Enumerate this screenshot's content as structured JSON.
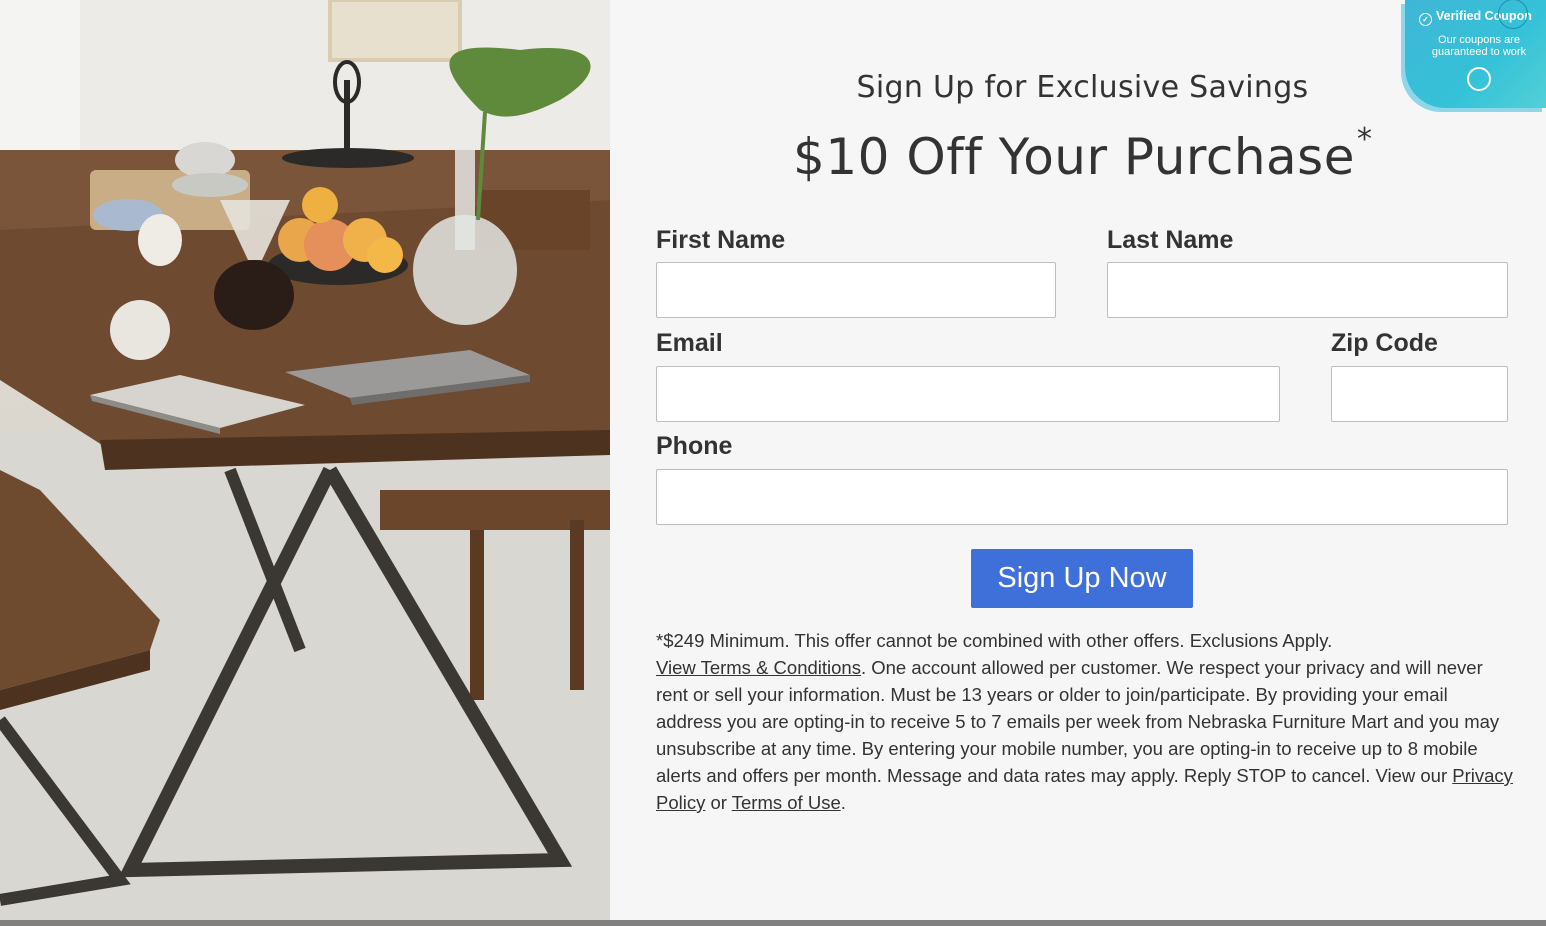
{
  "form": {
    "subtitle": "Sign Up for Exclusive Savings",
    "headline": "$10 Off Your Purchase",
    "headline_asterisk": "*",
    "fields": {
      "first_name": {
        "label": "First Name",
        "value": ""
      },
      "last_name": {
        "label": "Last Name",
        "value": ""
      },
      "email": {
        "label": "Email",
        "value": ""
      },
      "zip": {
        "label": "Zip Code",
        "value": ""
      },
      "phone": {
        "label": "Phone",
        "value": ""
      }
    },
    "submit_label": "Sign Up Now",
    "colors": {
      "button": "#3f6fd9",
      "background": "#f6f6f6",
      "text": "#333333"
    }
  },
  "disclaimer": {
    "line1": "*$249 Minimum. This offer cannot be combined with other offers. Exclusions Apply.",
    "terms_link": "View Terms & Conditions",
    "body": ". One account allowed per customer. We respect your privacy and will never rent or sell your information. Must be 13 years or older to join/participate. By providing your email address you are opting-in to receive 5 to 7 emails per week from Nebraska Furniture Mart and you may unsubscribe at any time. By entering your mobile number, you are opting-in to receive up to 8 mobile alerts and offers per month. Message and data rates may apply. Reply STOP to cancel. View our ",
    "privacy_link": "Privacy Policy",
    "or_text": " or ",
    "terms_of_use_link": "Terms of Use",
    "end": "."
  },
  "coupon_badge": {
    "title": "Verified Coupon",
    "subtitle": "Our coupons are guaranteed to work",
    "icons": [
      "check-circle-icon",
      "coupon-badge-icon",
      "close-icon"
    ],
    "color": "#3fb6d6"
  },
  "hero_image": {
    "icon": "dining-table-photo"
  }
}
